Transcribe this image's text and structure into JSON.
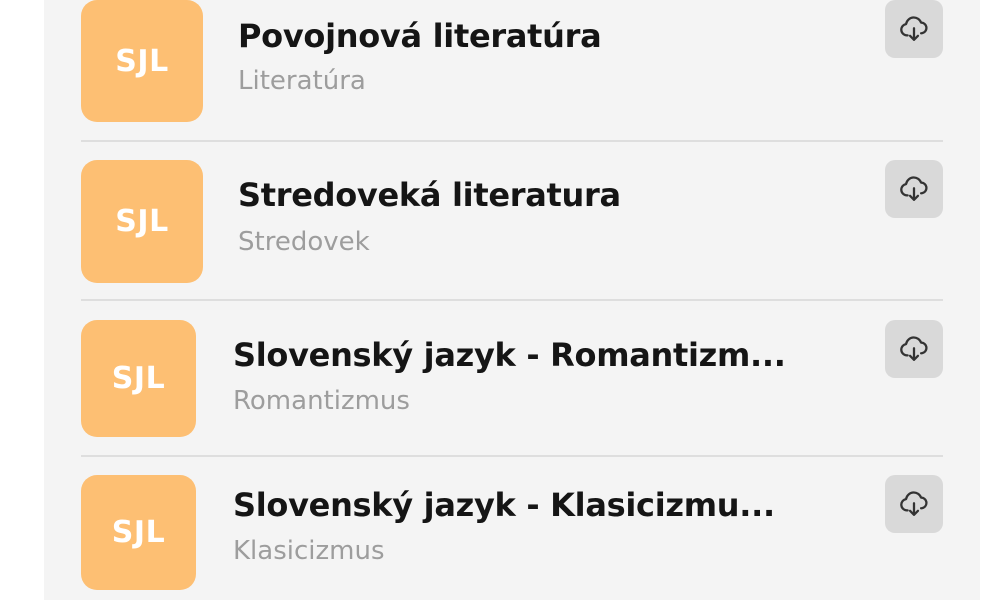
{
  "list": {
    "items": [
      {
        "badge": "SJL",
        "title": "Povojnová literatúra",
        "subtitle": "Literatúra",
        "download_icon": "cloud-download-icon"
      },
      {
        "badge": "SJL",
        "title": "Stredoveká literatura",
        "subtitle": "Stredovek",
        "download_icon": "cloud-download-icon"
      },
      {
        "badge": "SJL",
        "title": "Slovenský jazyk - Romantizm...",
        "subtitle": "Romantizmus",
        "download_icon": "cloud-download-icon"
      },
      {
        "badge": "SJL",
        "title": "Slovenský jazyk - Klasicizmu...",
        "subtitle": "Klasicizmus",
        "download_icon": "cloud-download-icon"
      }
    ]
  },
  "colors": {
    "badge_background": "#fdbf73",
    "badge_text": "#ffffff",
    "title_text": "#151515",
    "subtitle_text": "#9d9d9d",
    "panel_background": "#f4f4f4",
    "button_background": "#d9d9d9"
  }
}
